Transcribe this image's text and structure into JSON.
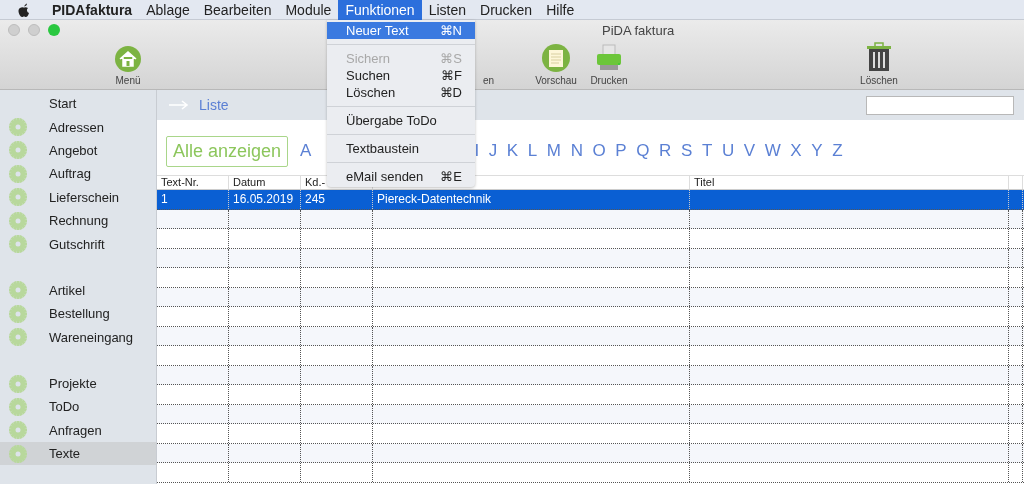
{
  "menu_bar": {
    "items": [
      {
        "label": "PIDAfaktura",
        "kind": "app",
        "selected": false
      },
      {
        "label": "Ablage",
        "kind": "menu",
        "selected": false
      },
      {
        "label": "Bearbeiten",
        "kind": "menu",
        "selected": false
      },
      {
        "label": "Module",
        "kind": "menu",
        "selected": false
      },
      {
        "label": "Funktionen",
        "kind": "menu",
        "selected": true
      },
      {
        "label": "Listen",
        "kind": "menu",
        "selected": false
      },
      {
        "label": "Drucken",
        "kind": "menu",
        "selected": false
      },
      {
        "label": "Hilfe",
        "kind": "menu",
        "selected": false
      }
    ]
  },
  "window": {
    "title": "PiDA faktura"
  },
  "toolbar": [
    {
      "label": "Menü",
      "kind": "home"
    },
    {
      "label": "en",
      "kind": "hidden"
    },
    {
      "label": "Vorschau",
      "kind": "preview"
    },
    {
      "label": "Drucken",
      "kind": "print"
    },
    {
      "label": "Löschen",
      "kind": "trash"
    }
  ],
  "sidebar": {
    "groups": [
      [
        {
          "label": "Start",
          "kind": "plain",
          "selected": false
        },
        {
          "label": "Adressen",
          "kind": "gear",
          "selected": false
        },
        {
          "label": "Angebot",
          "kind": "gear",
          "selected": false
        },
        {
          "label": "Auftrag",
          "kind": "gear",
          "selected": false
        },
        {
          "label": "Lieferschein",
          "kind": "gear",
          "selected": false
        },
        {
          "label": "Rechnung",
          "kind": "gear",
          "selected": false
        },
        {
          "label": "Gutschrift",
          "kind": "gear",
          "selected": false
        }
      ],
      [
        {
          "label": "Artikel",
          "kind": "gear",
          "selected": false
        },
        {
          "label": "Bestellung",
          "kind": "gear",
          "selected": false
        },
        {
          "label": "Wareneingang",
          "kind": "gear",
          "selected": false
        }
      ],
      [
        {
          "label": "Projekte",
          "kind": "gear",
          "selected": false
        },
        {
          "label": "ToDo",
          "kind": "gear",
          "selected": false
        },
        {
          "label": "Anfragen",
          "kind": "gear",
          "selected": false
        },
        {
          "label": "Texte",
          "kind": "gear",
          "selected": true
        }
      ]
    ]
  },
  "main": {
    "breadcrumb": "Liste",
    "show_all_button": "Alle anzeigen",
    "letters": [
      "A",
      "I",
      "J",
      "K",
      "L",
      "M",
      "N",
      "O",
      "P",
      "Q",
      "R",
      "S",
      "T",
      "U",
      "V",
      "W",
      "X",
      "Y",
      "Z"
    ]
  },
  "table": {
    "columns": [
      {
        "label": "Text-Nr."
      },
      {
        "label": "Datum"
      },
      {
        "label": "Kd.-"
      },
      {},
      {
        "label": "Titel"
      },
      {}
    ],
    "rows": [
      {
        "cells": [
          "1",
          "16.05.2019",
          "245",
          "Piereck-Datentechnik"
        ],
        "selected": true
      }
    ]
  },
  "dropdown_menu": {
    "items": [
      {
        "kind": "item",
        "label": "Neuer Text",
        "shortcut": "⌘N",
        "selected": true,
        "disabled": false
      },
      {
        "kind": "separator"
      },
      {
        "kind": "item",
        "label": "Sichern",
        "shortcut": "⌘S",
        "selected": false,
        "disabled": true
      },
      {
        "kind": "item",
        "label": "Suchen",
        "shortcut": "⌘F",
        "selected": false,
        "disabled": false
      },
      {
        "kind": "item",
        "label": "Löschen",
        "shortcut": "⌘D",
        "selected": false,
        "disabled": false
      },
      {
        "kind": "separator"
      },
      {
        "kind": "item",
        "label": "Übergabe ToDo",
        "selected": false,
        "disabled": false
      },
      {
        "kind": "separator"
      },
      {
        "kind": "item",
        "label": "Textbaustein",
        "selected": false,
        "disabled": false
      },
      {
        "kind": "separator"
      },
      {
        "kind": "item",
        "label": "eMail senden",
        "shortcut": "⌘E",
        "selected": false,
        "disabled": false
      }
    ]
  }
}
